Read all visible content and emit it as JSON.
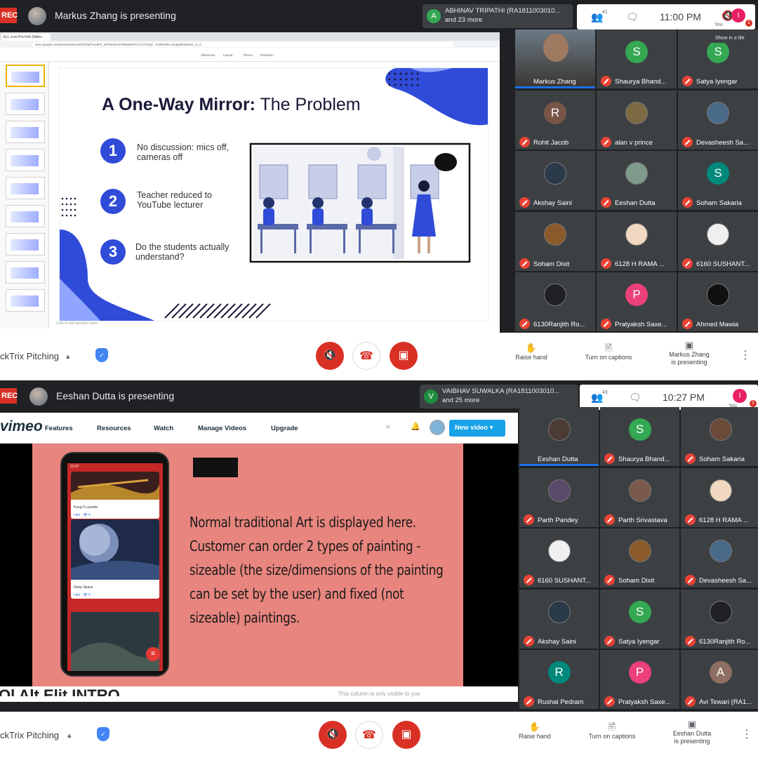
{
  "panel1": {
    "rec_label": "REC",
    "presenter_text": "Markus Zhang is presenting",
    "joined": {
      "initial": "A",
      "color": "#34a853",
      "line1": "ABHINAV TRIPATHI (RA1811003010...",
      "line2": "and 23 more"
    },
    "people_count": "41",
    "time": "11:00 PM",
    "you_initial": "I",
    "you_label": "You",
    "you_color": "#e91e63",
    "notif_count": "1",
    "show_tile_label": "Show in a tile",
    "browser_tab": "ELL-Live Pro Feb Slides - Google...",
    "url": "docs.google.com/presentation/d/1FEfaPVxe8Fb_sRFWUFmFRB5E4KPC1JzT3OgX.../edit#slide=id.g8d05a8e94c_0_0",
    "menu_items": [
      "Slideshow",
      "Layout",
      "Theme",
      "Transition"
    ],
    "slide": {
      "title_bold": "A One-Way Mirror:",
      "title_rest": " The Problem",
      "bullets": [
        {
          "num": "1",
          "text": "No discussion: mics off, cameras off"
        },
        {
          "num": "2",
          "text": "Teacher reduced to YouTube lecturer"
        },
        {
          "num": "3",
          "text": "Do the students actually understand?"
        }
      ],
      "question_mark": "?"
    },
    "speaker_notes": "Click to add speaker notes",
    "participants": [
      {
        "name": "Markus Zhang",
        "cam": true,
        "speaking": true
      },
      {
        "name": "Shaurya Bhand...",
        "initial": "S",
        "color": "#34a853"
      },
      {
        "name": "Satya Iyengar",
        "initial": "S",
        "color": "#34a853"
      },
      {
        "name": "Rohit Jacob",
        "initial": "R",
        "color": "#795548"
      },
      {
        "name": "alan v prince",
        "photo": "#7c6a42"
      },
      {
        "name": "Devasheesh Sa...",
        "photo": "#4a6a8a"
      },
      {
        "name": "Akshay Saini",
        "photo": "#2b3a4a"
      },
      {
        "name": "Eeshan Dutta",
        "photo": "#7d9a8a"
      },
      {
        "name": "Soham Sakaria",
        "initial": "S",
        "color": "#00897b"
      },
      {
        "name": "Soham Dixit",
        "photo": "#8a5a2a"
      },
      {
        "name": "6128 H RAMA ...",
        "photo": "#f0d9c0"
      },
      {
        "name": "6160 SUSHANT...",
        "photo": "#f0f0f0"
      },
      {
        "name": "6130Ranjith Ro...",
        "photo": "#202124"
      },
      {
        "name": "Pratyaksh Saxe...",
        "initial": "P",
        "color": "#ec407a"
      },
      {
        "name": "Ahmed Mawia",
        "photo": "#111"
      }
    ],
    "meeting_name": "ckTrix Pitching",
    "raise_hand": "Raise hand",
    "captions": "Turn on captions",
    "presenting_line1": "Markus Zhang",
    "presenting_line2": "is presenting"
  },
  "panel2": {
    "rec_label": "REC",
    "presenter_text": "Eeshan Dutta is presenting",
    "joined": {
      "initial": "V",
      "color": "#1e8e3e",
      "line1": "VAIBHAV SUWALKA (RA1811003010...",
      "line2": "and 25 more"
    },
    "people_count": "43",
    "time": "10:27 PM",
    "you_initial": "I",
    "you_label": "You",
    "you_color": "#e91e63",
    "notif_count": "1",
    "vimeo": {
      "logo": "vimeo",
      "nav": [
        "Features",
        "Resources",
        "Watch",
        "Manage Videos",
        "Upgrade"
      ],
      "new_video": "New video"
    },
    "phone": {
      "time": "12:07",
      "card1": "Kung Fu panda",
      "card2": "Deep Space",
      "like": "Like",
      "views": "0"
    },
    "description": "Normal traditional Art is displayed here. Customer can order 2 types of painting - sizeable (the size/dimensions of the painting can be set by the user) and fixed (not sizeable) paintings.",
    "intro_cut": "Ol Alt Elit INTRO",
    "column_note": "This column is only visible to you",
    "participants": [
      {
        "name": "Eeshan Dutta",
        "photo": "#4a3c33",
        "speaking": true
      },
      {
        "name": "Shaurya Bhand...",
        "initial": "S",
        "color": "#34a853"
      },
      {
        "name": "Soham Sakaria",
        "photo": "#6b4a3a"
      },
      {
        "name": "Parth Pandey",
        "photo": "#5a4a6a"
      },
      {
        "name": "Parth Srivastava",
        "photo": "#7a5a4a"
      },
      {
        "name": "6128 H RAMA ...",
        "photo": "#f0d9c0"
      },
      {
        "name": "6160 SUSHANT...",
        "photo": "#f0f0f0"
      },
      {
        "name": "Soham Dixit",
        "photo": "#8a5a2a"
      },
      {
        "name": "Devasheesh Sa...",
        "photo": "#4a6a8a"
      },
      {
        "name": "Akshay Saini",
        "photo": "#2b3a4a"
      },
      {
        "name": "Satya Iyengar",
        "initial": "S",
        "color": "#34a853"
      },
      {
        "name": "6130Ranjith Ro...",
        "photo": "#202124"
      },
      {
        "name": "Rushal Pedram",
        "initial": "R",
        "color": "#00897b"
      },
      {
        "name": "Pratyaksh Saxe...",
        "initial": "P",
        "color": "#ec407a"
      },
      {
        "name": "Avi Tewari (RA1...",
        "initial": "A",
        "color": "#8d6e63"
      }
    ],
    "meeting_name": "ckTrix Pitching",
    "raise_hand": "Raise hand",
    "captions": "Turn on captions",
    "presenting_line1": "Eeshan Dutta",
    "presenting_line2": "is presenting"
  }
}
